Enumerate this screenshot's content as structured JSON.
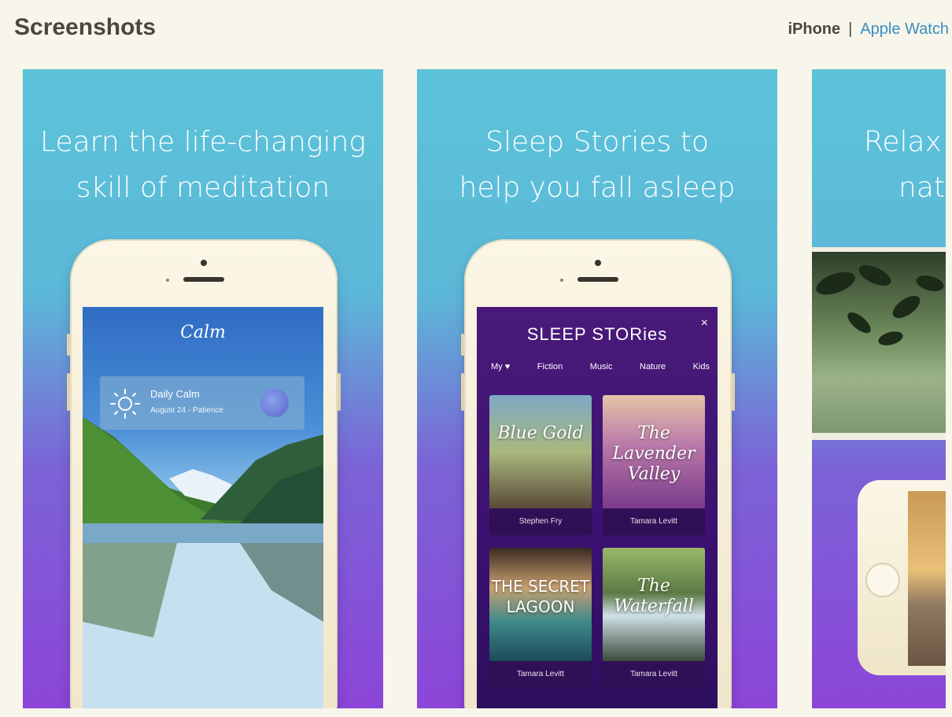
{
  "header": {
    "title": "Screenshots",
    "device_tabs": {
      "active": "iPhone",
      "separator": "|",
      "other": "Apple Watch"
    }
  },
  "screenshots": [
    {
      "caption_lines": [
        "Learn the life-changing",
        "skill of meditation"
      ],
      "app": {
        "logo": "Calm",
        "card_title": "Daily Calm",
        "card_subtitle": "August 24 - Patience"
      }
    },
    {
      "caption_lines": [
        "Sleep Stories to",
        "help you fall asleep"
      ],
      "app": {
        "title": "SLEEP STORies",
        "close": "×",
        "tabs": [
          "My ♥",
          "Fiction",
          "Music",
          "Nature",
          "Kids"
        ],
        "stories": [
          {
            "title": "Blue Gold",
            "author": "Stephen Fry"
          },
          {
            "title": "The Lavender Valley",
            "author": "Tamara Levitt"
          },
          {
            "title": "THE SECRET LAGOON",
            "author": "Tamara Levitt"
          },
          {
            "title": "The Waterfall",
            "author": "Tamara Levitt"
          }
        ]
      }
    },
    {
      "caption_lines": [
        "Relax w",
        "natu"
      ]
    }
  ],
  "colors": {
    "gradient_top": "#5cc3d9",
    "gradient_bottom": "#8c45d8",
    "link": "#3a8fc4"
  }
}
